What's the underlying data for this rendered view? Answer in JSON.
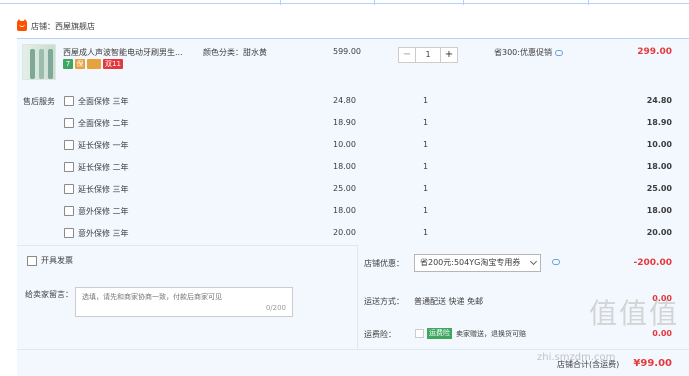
{
  "shop": {
    "name": "店铺：西屋旗舰店",
    "icon": "tmall-icon"
  },
  "item": {
    "title": "西屋成人声波智能电动牙刷男生...",
    "sku": "颜色分类：甜水黄",
    "badges": [
      "7",
      "保",
      "",
      "双11"
    ],
    "unit_price": "599.00",
    "quantity": "1",
    "promo": "省300:优惠促销",
    "subtotal": "299.00"
  },
  "services": {
    "title": "售后服务",
    "rows": [
      {
        "name": "全面保修 三年",
        "price": "24.80",
        "qty": "1",
        "total": "24.80"
      },
      {
        "name": "全面保修 二年",
        "price": "18.90",
        "qty": "1",
        "total": "18.90"
      },
      {
        "name": "延长保修 一年",
        "price": "10.00",
        "qty": "1",
        "total": "10.00"
      },
      {
        "name": "延长保修 二年",
        "price": "18.00",
        "qty": "1",
        "total": "18.00"
      },
      {
        "name": "延长保修 三年",
        "price": "25.00",
        "qty": "1",
        "total": "25.00"
      },
      {
        "name": "意外保修 二年",
        "price": "18.00",
        "qty": "1",
        "total": "18.00"
      },
      {
        "name": "意外保修 三年",
        "price": "20.00",
        "qty": "1",
        "total": "20.00"
      }
    ]
  },
  "invoice": {
    "label": "开具发票"
  },
  "message": {
    "label": "给卖家留言：",
    "placeholder": "选填，请先和商家协商一致，付款后商家可见",
    "count": "0/200"
  },
  "coupon": {
    "label": "店铺优惠：",
    "selected": "省200元:504YG淘宝专用券",
    "amount": "-200.00"
  },
  "shipping": {
    "label": "运送方式：",
    "value": "普通配送 快递 免邮",
    "amount": "0.00"
  },
  "insurance": {
    "label": "运费险：",
    "tag": "运费险",
    "text": "卖家赠送，退换货可赔",
    "amount": "0.00"
  },
  "total": {
    "label": "店铺合计(含运费)",
    "amount": "¥99.00"
  },
  "watermark": {
    "text": "值值值",
    "url": "zhi.smzdm.com"
  }
}
